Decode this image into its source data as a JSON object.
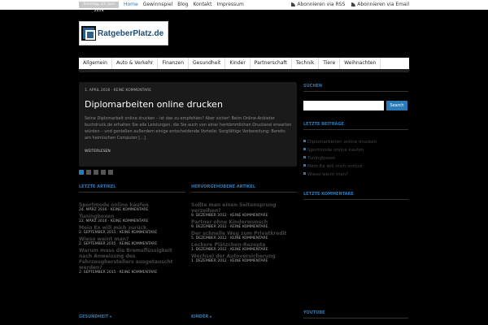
{
  "topbar": {
    "date": "Sonntag, 23. Juni 2019",
    "nav": [
      "Home",
      "Gewinnspiel",
      "Blog",
      "Kontakt",
      "Impressum"
    ],
    "subscribe": [
      "Abonnieren via RSS",
      "Abonnieren via Email"
    ]
  },
  "logo": {
    "text": "RatgeberPlatz.de"
  },
  "mainnav": [
    "Allgemein",
    "Auto & Verkehr",
    "Finanzen",
    "Gesundheit",
    "Kinder",
    "Partnerschaft",
    "Technik",
    "Tiere",
    "Weihnachten"
  ],
  "feature": {
    "meta": "1. APRIL 2016 · KEINE KOMMENTARE",
    "title": "Diplomarbeiten online drucken",
    "excerpt": "Seine Diplomarbeit online drucken – ist das zu empfehlen? Aber sicher! Beim Online-Anbieter buchdruck.de erhalten Sie alle Leistungen, die Sie auch von einer herkömmlichen Druckerei erwarten würden – und genießen außerdem einige entscheidende Vorteile: Sorgfältige Vorbereitung: Bereits am heimischen Computer […]",
    "more": "WEITERLESEN"
  },
  "sections": {
    "latest": "LETZTE ARTIKEL",
    "featured": "HERVORGEHOBENE ARTIKEL",
    "gesundheit": "GESUNDHEIT ▸",
    "kinder": "KINDER ▸",
    "search": "SUCHEN",
    "latest_posts": "LETZTE BEITRÄGE",
    "latest_comments": "LETZTE KOMMENTARE",
    "youtube": "YOUTUBE"
  },
  "latest_articles": [
    {
      "title": "Sportmode online kaufen",
      "meta": "24. MÄRZ 2016 · KEINE KOMMENTARE"
    },
    {
      "title": "Tuningboxen",
      "meta": "22. MÄRZ 2016 · KEINE KOMMENTARE"
    },
    {
      "title": "Mein Ex will mich zurück",
      "meta": "2. SEPTEMBER 2015 · KEINE KOMMENTARE"
    },
    {
      "title": "Wieso weint man?",
      "meta": "2. SEPTEMBER 2015 · KEINE KOMMENTARE"
    },
    {
      "title": "Warum muss die Bremsflüssigkeit nach Anweisung des Fahrzeugherstellers ausgetauscht werden?",
      "meta": "2. SEPTEMBER 2015 · KEINE KOMMENTARE"
    }
  ],
  "featured_articles": [
    {
      "title": "Sollte man einen Seitensprung verzeihen?",
      "meta": "9. DEZEMBER 2012 · KEINE KOMMENTARE"
    },
    {
      "title": "Partner ohne Kinderwunsch",
      "meta": "9. DEZEMBER 2012 · KEINE KOMMENTARE"
    },
    {
      "title": "Der schnelle Weg zum Privatkredit",
      "meta": "5. DEZEMBER 2012 · KEINE KOMMENTARE"
    },
    {
      "title": "Leckere Plätzchen-Rezepte",
      "meta": "1. DEZEMBER 2012 · KEINE KOMMENTARE"
    },
    {
      "title": "Wechsel der Autoversicherung",
      "meta": "1. DEZEMBER 2012 · KEINE KOMMENTARE"
    }
  ],
  "search": {
    "button": "Search",
    "placeholder": ""
  },
  "sidebar_posts": [
    "Diplomarbeiten online drucken",
    "Sportmode online kaufen",
    "Tuningboxen",
    "Mein Ex will mich zurück",
    "Wieso weint man?"
  ],
  "colors": {
    "accent": "#2a7ab8",
    "background": "#000000"
  }
}
